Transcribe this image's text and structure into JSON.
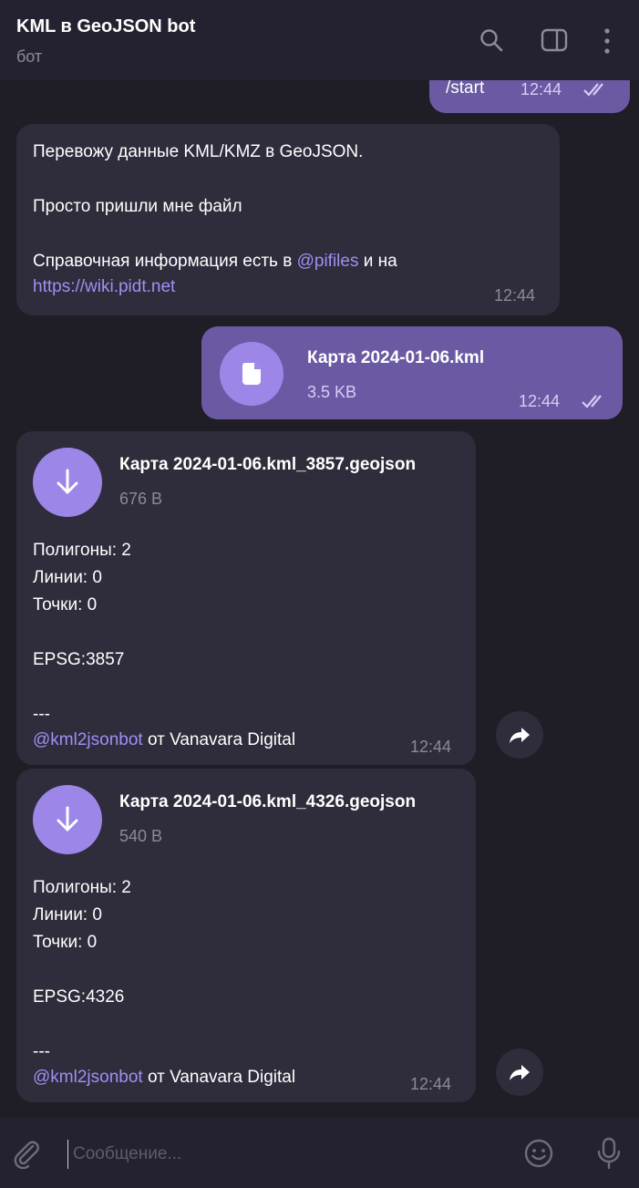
{
  "header": {
    "title": "KML в GeoJSON bot",
    "subtitle": "бот"
  },
  "messages": {
    "start": {
      "text": "/start",
      "time": "12:44"
    },
    "welcome": {
      "line1": "Перевожу данные KML/KMZ в GeoJSON.",
      "line2": "Просто пришли мне файл",
      "line3_prefix": "Справочная информация есть в ",
      "line3_link": "@pifiles",
      "line3_suffix": " и на",
      "link2": "https://wiki.pidt.net",
      "time": "12:44"
    },
    "upload": {
      "file_name": "Карта 2024-01-06.kml",
      "file_size": "3.5 KB",
      "time": "12:44"
    },
    "result1": {
      "file_name": "Карта 2024-01-06.kml_3857.geojson",
      "file_size": "676 B",
      "polygons": "Полигоны: 2",
      "lines": "Линии: 0",
      "points": "Точки: 0",
      "epsg": "EPSG:3857",
      "separator": "---",
      "bot_link": "@kml2jsonbot",
      "signature": " от Vanavara Digital",
      "time": "12:44"
    },
    "result2": {
      "file_name": "Карта 2024-01-06.kml_4326.geojson",
      "file_size": "540 B",
      "polygons": "Полигоны: 2",
      "lines": "Линии: 0",
      "points": "Точки: 0",
      "epsg": "EPSG:4326",
      "separator": "---",
      "bot_link": "@kml2jsonbot",
      "signature": " от Vanavara Digital",
      "time": "12:44"
    }
  },
  "composer": {
    "placeholder": "Сообщение..."
  },
  "colors": {
    "background": "#1f1d26",
    "incoming": "#2f2c3b",
    "outgoing": "#6b5aa3",
    "accent": "#9c86e8",
    "link": "#a28ef5"
  },
  "icons": [
    "search-icon",
    "sidebar-toggle-icon",
    "more-vertical-icon",
    "document-icon",
    "download-icon",
    "forward-icon",
    "paperclip-icon",
    "emoji-icon",
    "microphone-icon",
    "double-check-icon"
  ]
}
